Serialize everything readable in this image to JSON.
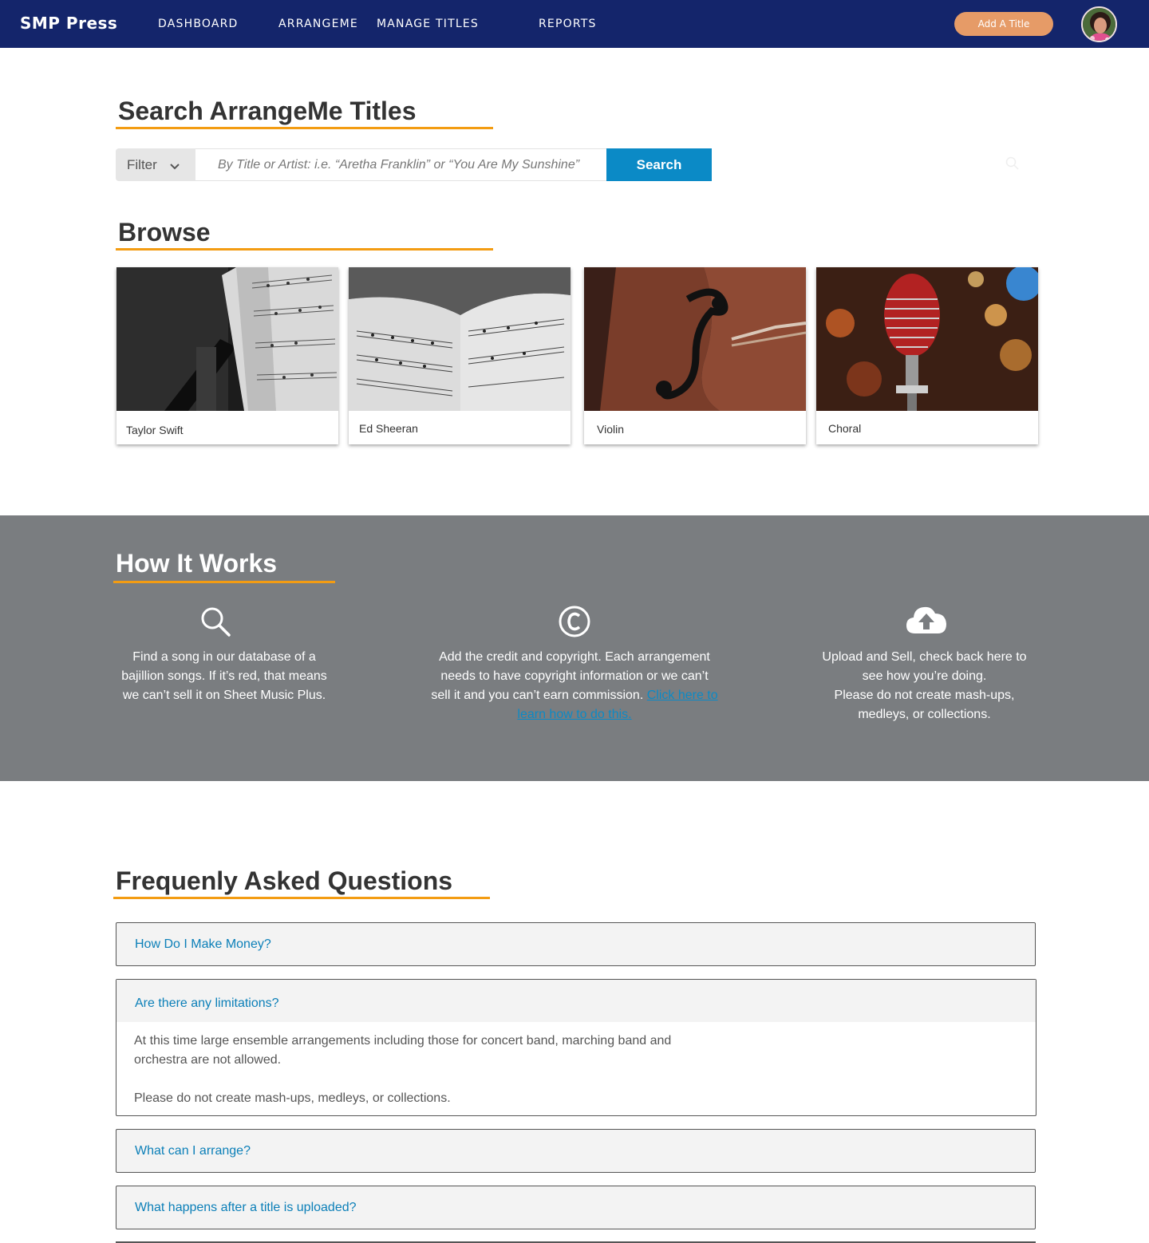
{
  "nav": {
    "brand": "SMP Press",
    "links": [
      "DASHBOARD",
      "ARRANGEME",
      "MANAGE TITLES",
      "REPORTS"
    ],
    "add_button": "Add A Title"
  },
  "search": {
    "title": "Search ArrangeMe Titles",
    "filter_label": "Filter",
    "placeholder": "By Title or Artist: i.e. “Aretha Franklin” or “You Are My Sunshine”",
    "button": "Search"
  },
  "browse": {
    "title": "Browse",
    "cards": [
      {
        "label": "Taylor Swift"
      },
      {
        "label": "Ed Sheeran"
      },
      {
        "label": "Violin"
      },
      {
        "label": "Choral"
      }
    ]
  },
  "how": {
    "title": "How It Works",
    "steps": [
      {
        "icon": "search-icon",
        "text": "Find a song in our database of a bajillion songs. If it’s red, that means we can’t sell it on Sheet Music Plus."
      },
      {
        "icon": "copyright-icon",
        "text": "Add the credit and copyright. Each arrangement needs to have copyright information or we can’t sell it and you can’t earn commission.",
        "link": "Click here to learn how to do this."
      },
      {
        "icon": "cloud-upload-icon",
        "text": "Upload and Sell, check back here to see how you’re doing.",
        "text2": "Please do not create mash-ups, medleys, or collections."
      }
    ]
  },
  "faq": {
    "title": "Frequenly Asked Questions",
    "items": [
      {
        "q": "How Do I Make Money?"
      },
      {
        "q": "Are there any limitations?",
        "a1": "At this time large ensemble arrangements including those for concert band, marching band and orchestra are not allowed.",
        "a2": "Please do not create mash-ups, medleys, or collections."
      },
      {
        "q": "What can I arrange?"
      },
      {
        "q": "What happens after a title is uploaded?"
      }
    ]
  },
  "colors": {
    "nav_bg": "#14256b",
    "accent_orange": "#f39c12",
    "add_button": "#e69b67",
    "primary_blue": "#0b8ac6",
    "how_bg": "#7a7d80"
  }
}
